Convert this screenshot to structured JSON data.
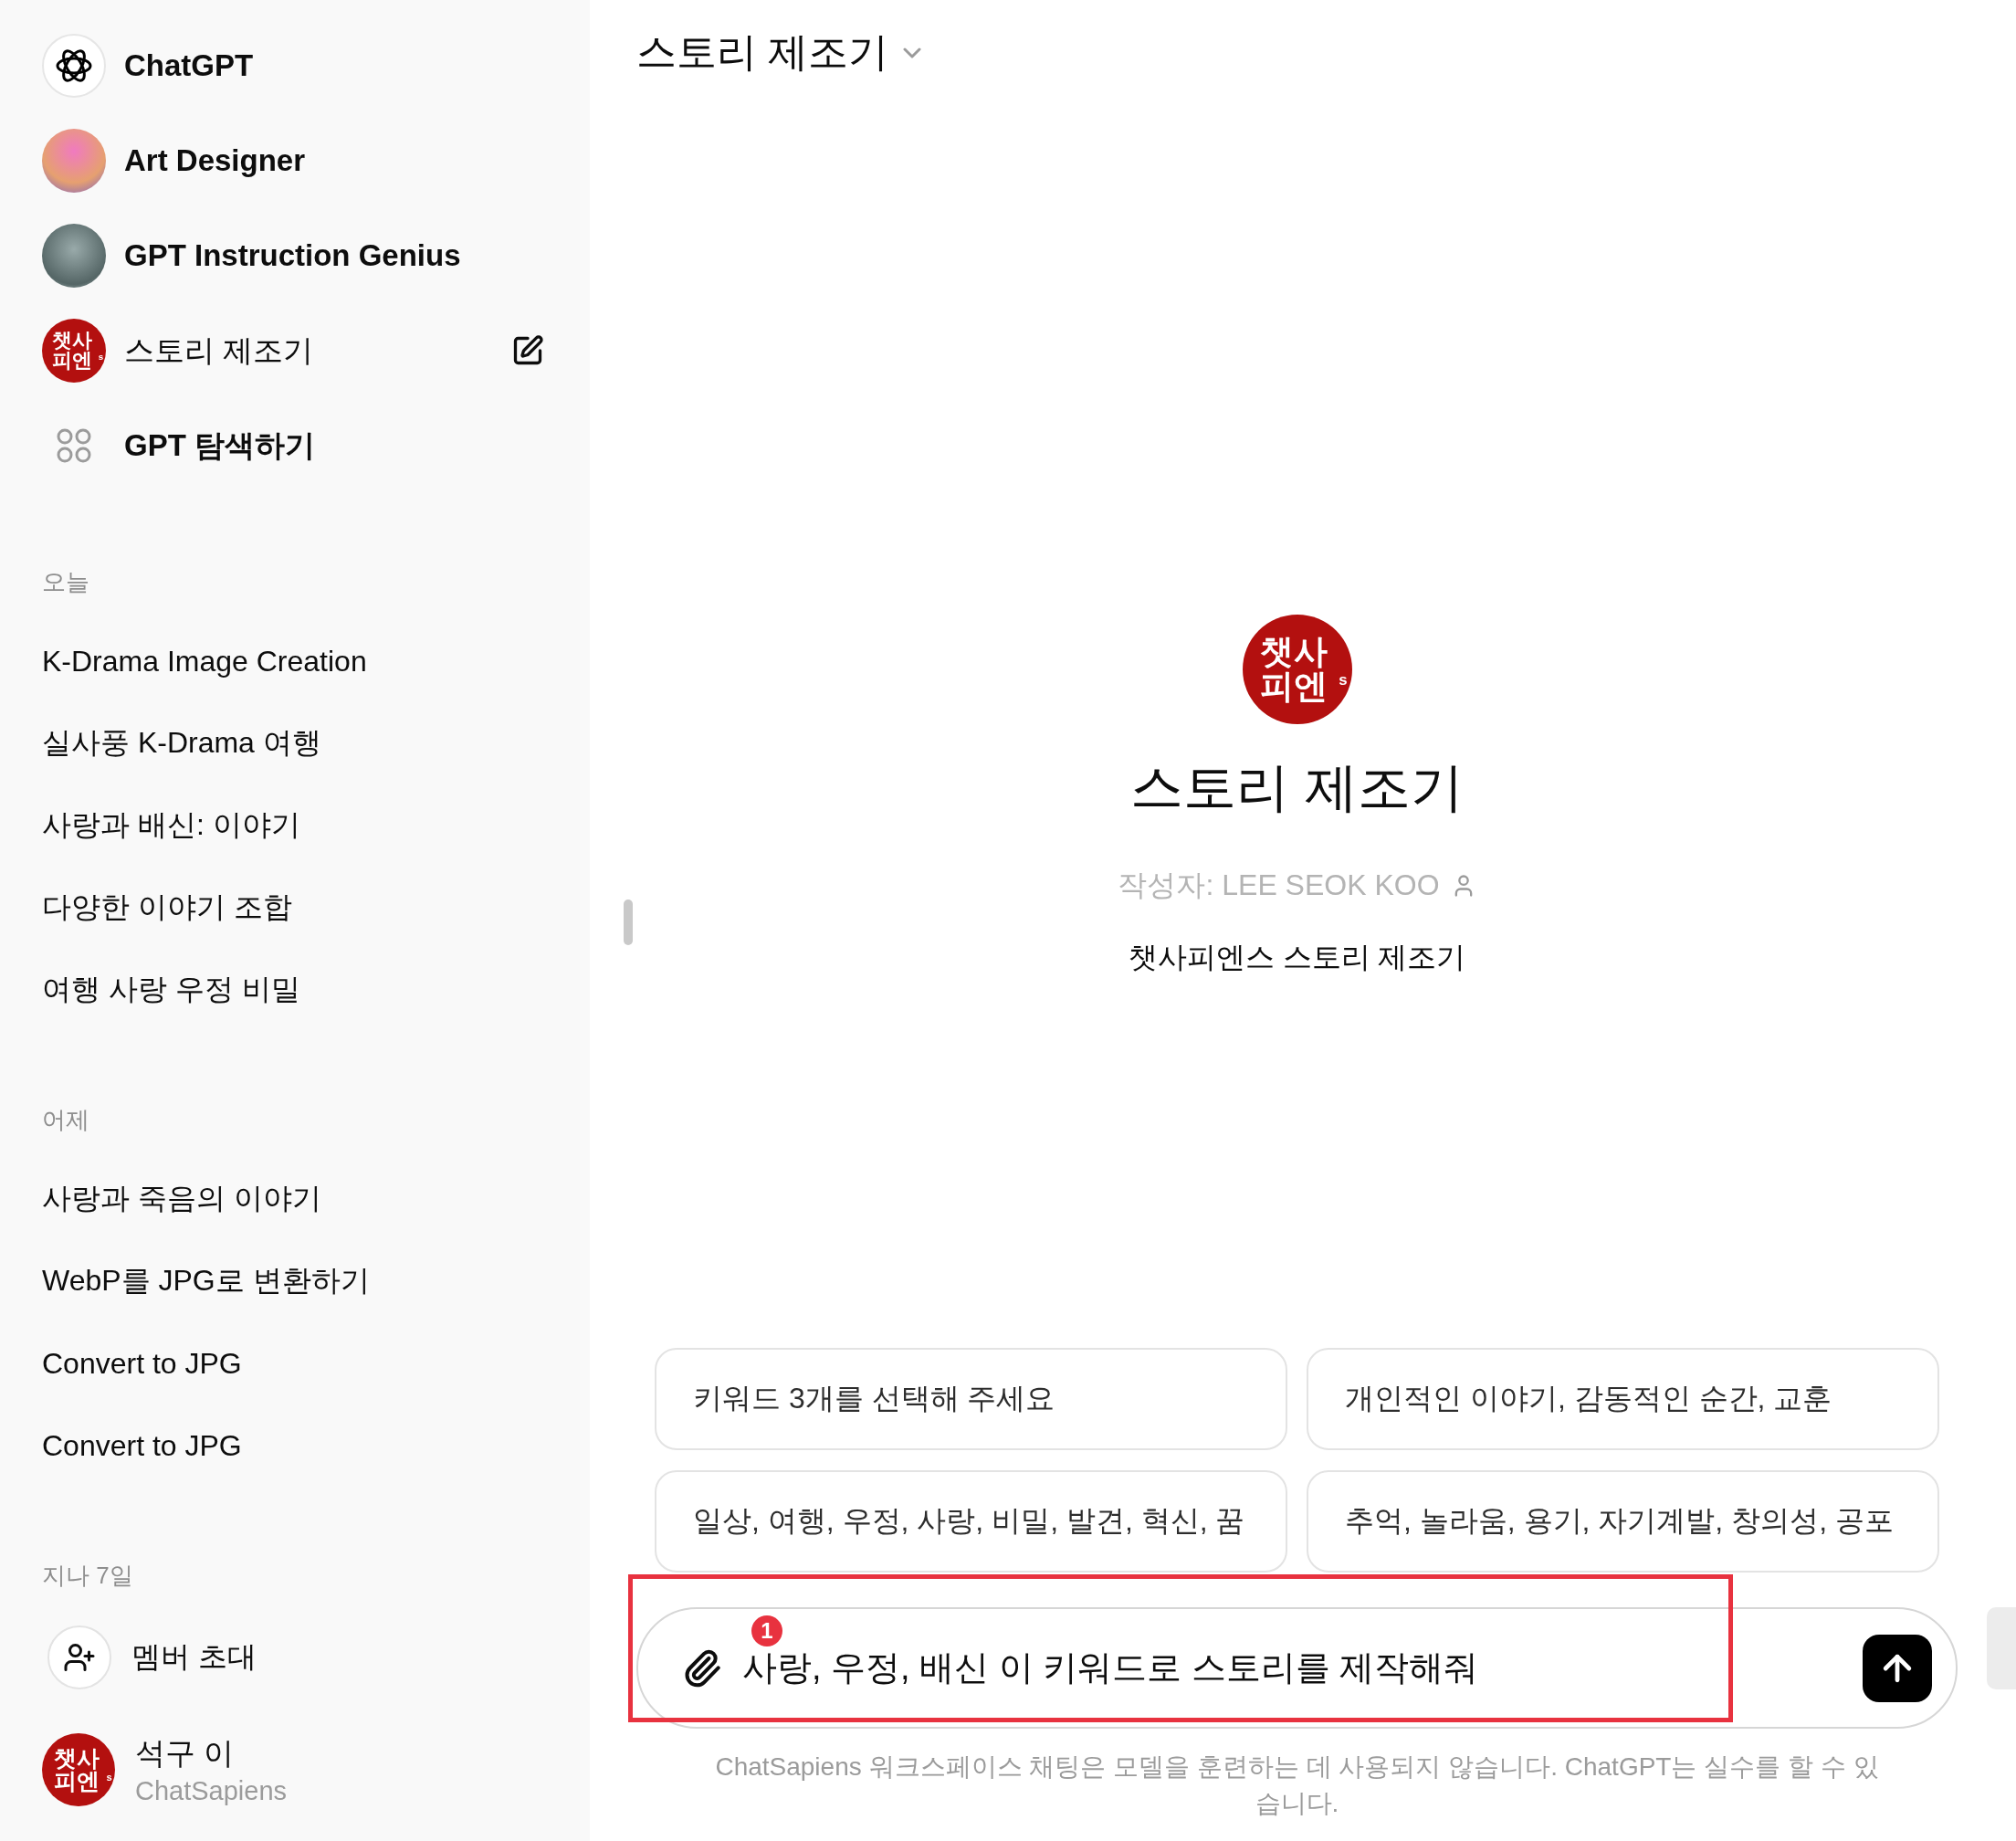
{
  "sidebar": {
    "gpts": [
      {
        "kind": "openai",
        "label": "ChatGPT",
        "edit": false
      },
      {
        "kind": "photo",
        "label": "Art Designer",
        "edit": false
      },
      {
        "kind": "photo",
        "label": "GPT Instruction Genius",
        "edit": false
      },
      {
        "kind": "logo",
        "label": "스토리 제조기",
        "logo": [
          "챗사",
          "피엔",
          "s"
        ],
        "edit": true
      },
      {
        "kind": "grid",
        "label": "GPT 탐색하기",
        "edit": false
      }
    ],
    "history": [
      {
        "heading": "오늘",
        "items": [
          "K-Drama Image Creation",
          "실사풍 K-Drama 여행",
          "사랑과 배신: 이야기",
          "다양한 이야기 조합",
          "여행 사랑 우정 비밀"
        ]
      },
      {
        "heading": "어제",
        "items": [
          "사랑과 죽음의 이야기",
          "WebP를 JPG로 변환하기",
          "Convert to JPG",
          "Convert to JPG"
        ]
      },
      {
        "heading": "지나 7일"
      }
    ],
    "invite": {
      "label": "멤버 초대"
    },
    "user": {
      "name": "석구 이",
      "workspace": "ChatSapiens",
      "logo": [
        "챗사",
        "피엔",
        "s"
      ]
    }
  },
  "main": {
    "header": {
      "title": "스토리 제조기"
    },
    "gpt": {
      "logo": [
        "챗사",
        "피엔",
        "s"
      ],
      "name": "스토리 제조기",
      "author": "작성자: LEE SEOK KOO",
      "description": "챗사피엔스 스토리 제조기"
    },
    "suggestions": [
      "키워드 3개를 선택해 주세요",
      "개인적인 이야기, 감동적인 순간, 교훈",
      "일상, 여행, 우정, 사랑, 비밀, 발견, 혁신, 꿈",
      "추억, 놀라움, 용기, 자기계발, 창의성, 공포"
    ],
    "composer": {
      "value": "사랑, 우정, 배신 이 키워드로 스토리를 제작해줘"
    },
    "annotation": {
      "number": "1"
    },
    "disclaimer": "ChatSapiens 워크스페이스 채팅은 모델을 훈련하는 데 사용되지 않습니다. ChatGPT는 실수를 할 수 있습니다."
  }
}
